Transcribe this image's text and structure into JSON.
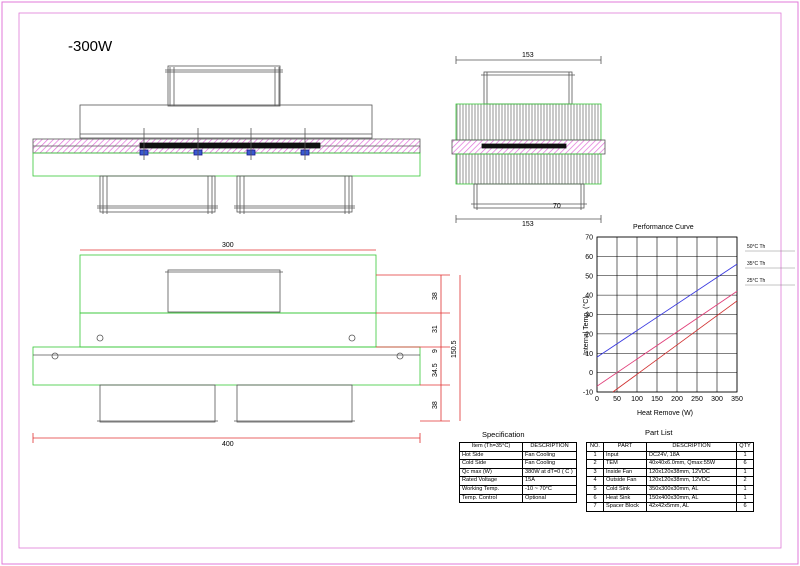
{
  "title": "-300W",
  "dimensions": {
    "side_top_width": "153",
    "side_bottom_width": "153",
    "side_inner": "70",
    "front_top_width": "300",
    "front_bottom_width": "400",
    "h_top": "38",
    "h_mid": "31",
    "h_base": "9",
    "h_lower": "34.5",
    "h_bottom": "38",
    "h_total": "150.5"
  },
  "chart_data": {
    "type": "line",
    "title": "Performance Curve",
    "xlabel": "Heat Remove (W)",
    "ylabel": "Internal Temp. (°C)",
    "xlim": [
      0,
      350
    ],
    "ylim": [
      -10,
      70
    ],
    "xticks": [
      "0",
      "50",
      "100",
      "150",
      "200",
      "250",
      "300",
      "350"
    ],
    "yticks": [
      "-10",
      "0",
      "10",
      "20",
      "30",
      "40",
      "50",
      "60",
      "70"
    ],
    "grid": true,
    "series": [
      {
        "name": "50°C Th",
        "color": "#3a3ae0",
        "x": [
          0,
          350
        ],
        "y": [
          8,
          56
        ]
      },
      {
        "name": "35°C Th",
        "color": "#e0407a",
        "x": [
          0,
          350
        ],
        "y": [
          -7,
          42
        ]
      },
      {
        "name": "25°C Th",
        "color": "#d03030",
        "x": [
          0,
          350
        ],
        "y": [
          -16,
          37
        ]
      }
    ]
  },
  "specification": {
    "caption": "Specification",
    "headers": [
      "Item (Th=35°C)",
      "DESCRIPTION"
    ],
    "rows": [
      [
        "Hot Side",
        "Fan Cooling"
      ],
      [
        "Cold Side",
        "Fan Cooling"
      ],
      [
        "Qc max (W)",
        "380W at dT=0 ( C )"
      ],
      [
        "Rated Voltage",
        "15A"
      ],
      [
        "Working Temp.",
        "-10 ~ 70°C"
      ],
      [
        "Temp. Control",
        "Optional"
      ]
    ]
  },
  "part_list": {
    "caption": "Part List",
    "headers": [
      "NO.",
      "PART",
      "DESCRIPTION",
      "QTY"
    ],
    "rows": [
      [
        "1",
        "Input",
        "DC24V, 18A",
        "1"
      ],
      [
        "2",
        "TEM",
        "40x40x6.0mm, Qmax:55W",
        "6"
      ],
      [
        "3",
        "Inside Fan",
        "120x120x38mm, 12VDC",
        "1"
      ],
      [
        "4",
        "Outside Fan",
        "120x120x38mm, 12VDC",
        "2"
      ],
      [
        "5",
        "Cold Sink",
        "350x300x30mm, AL",
        "1"
      ],
      [
        "6",
        "Heat Sink",
        "150x400x30mm, AL",
        "1"
      ],
      [
        "7",
        "Spacer Block",
        "42x42x5mm, AL",
        "6"
      ]
    ]
  },
  "colors": {
    "frame": "#e07ad8",
    "outline": "#555555",
    "green": "#37c837",
    "dim_red": "#e03030",
    "hatch": "#e070d8",
    "tec": "#1a1a8a"
  }
}
